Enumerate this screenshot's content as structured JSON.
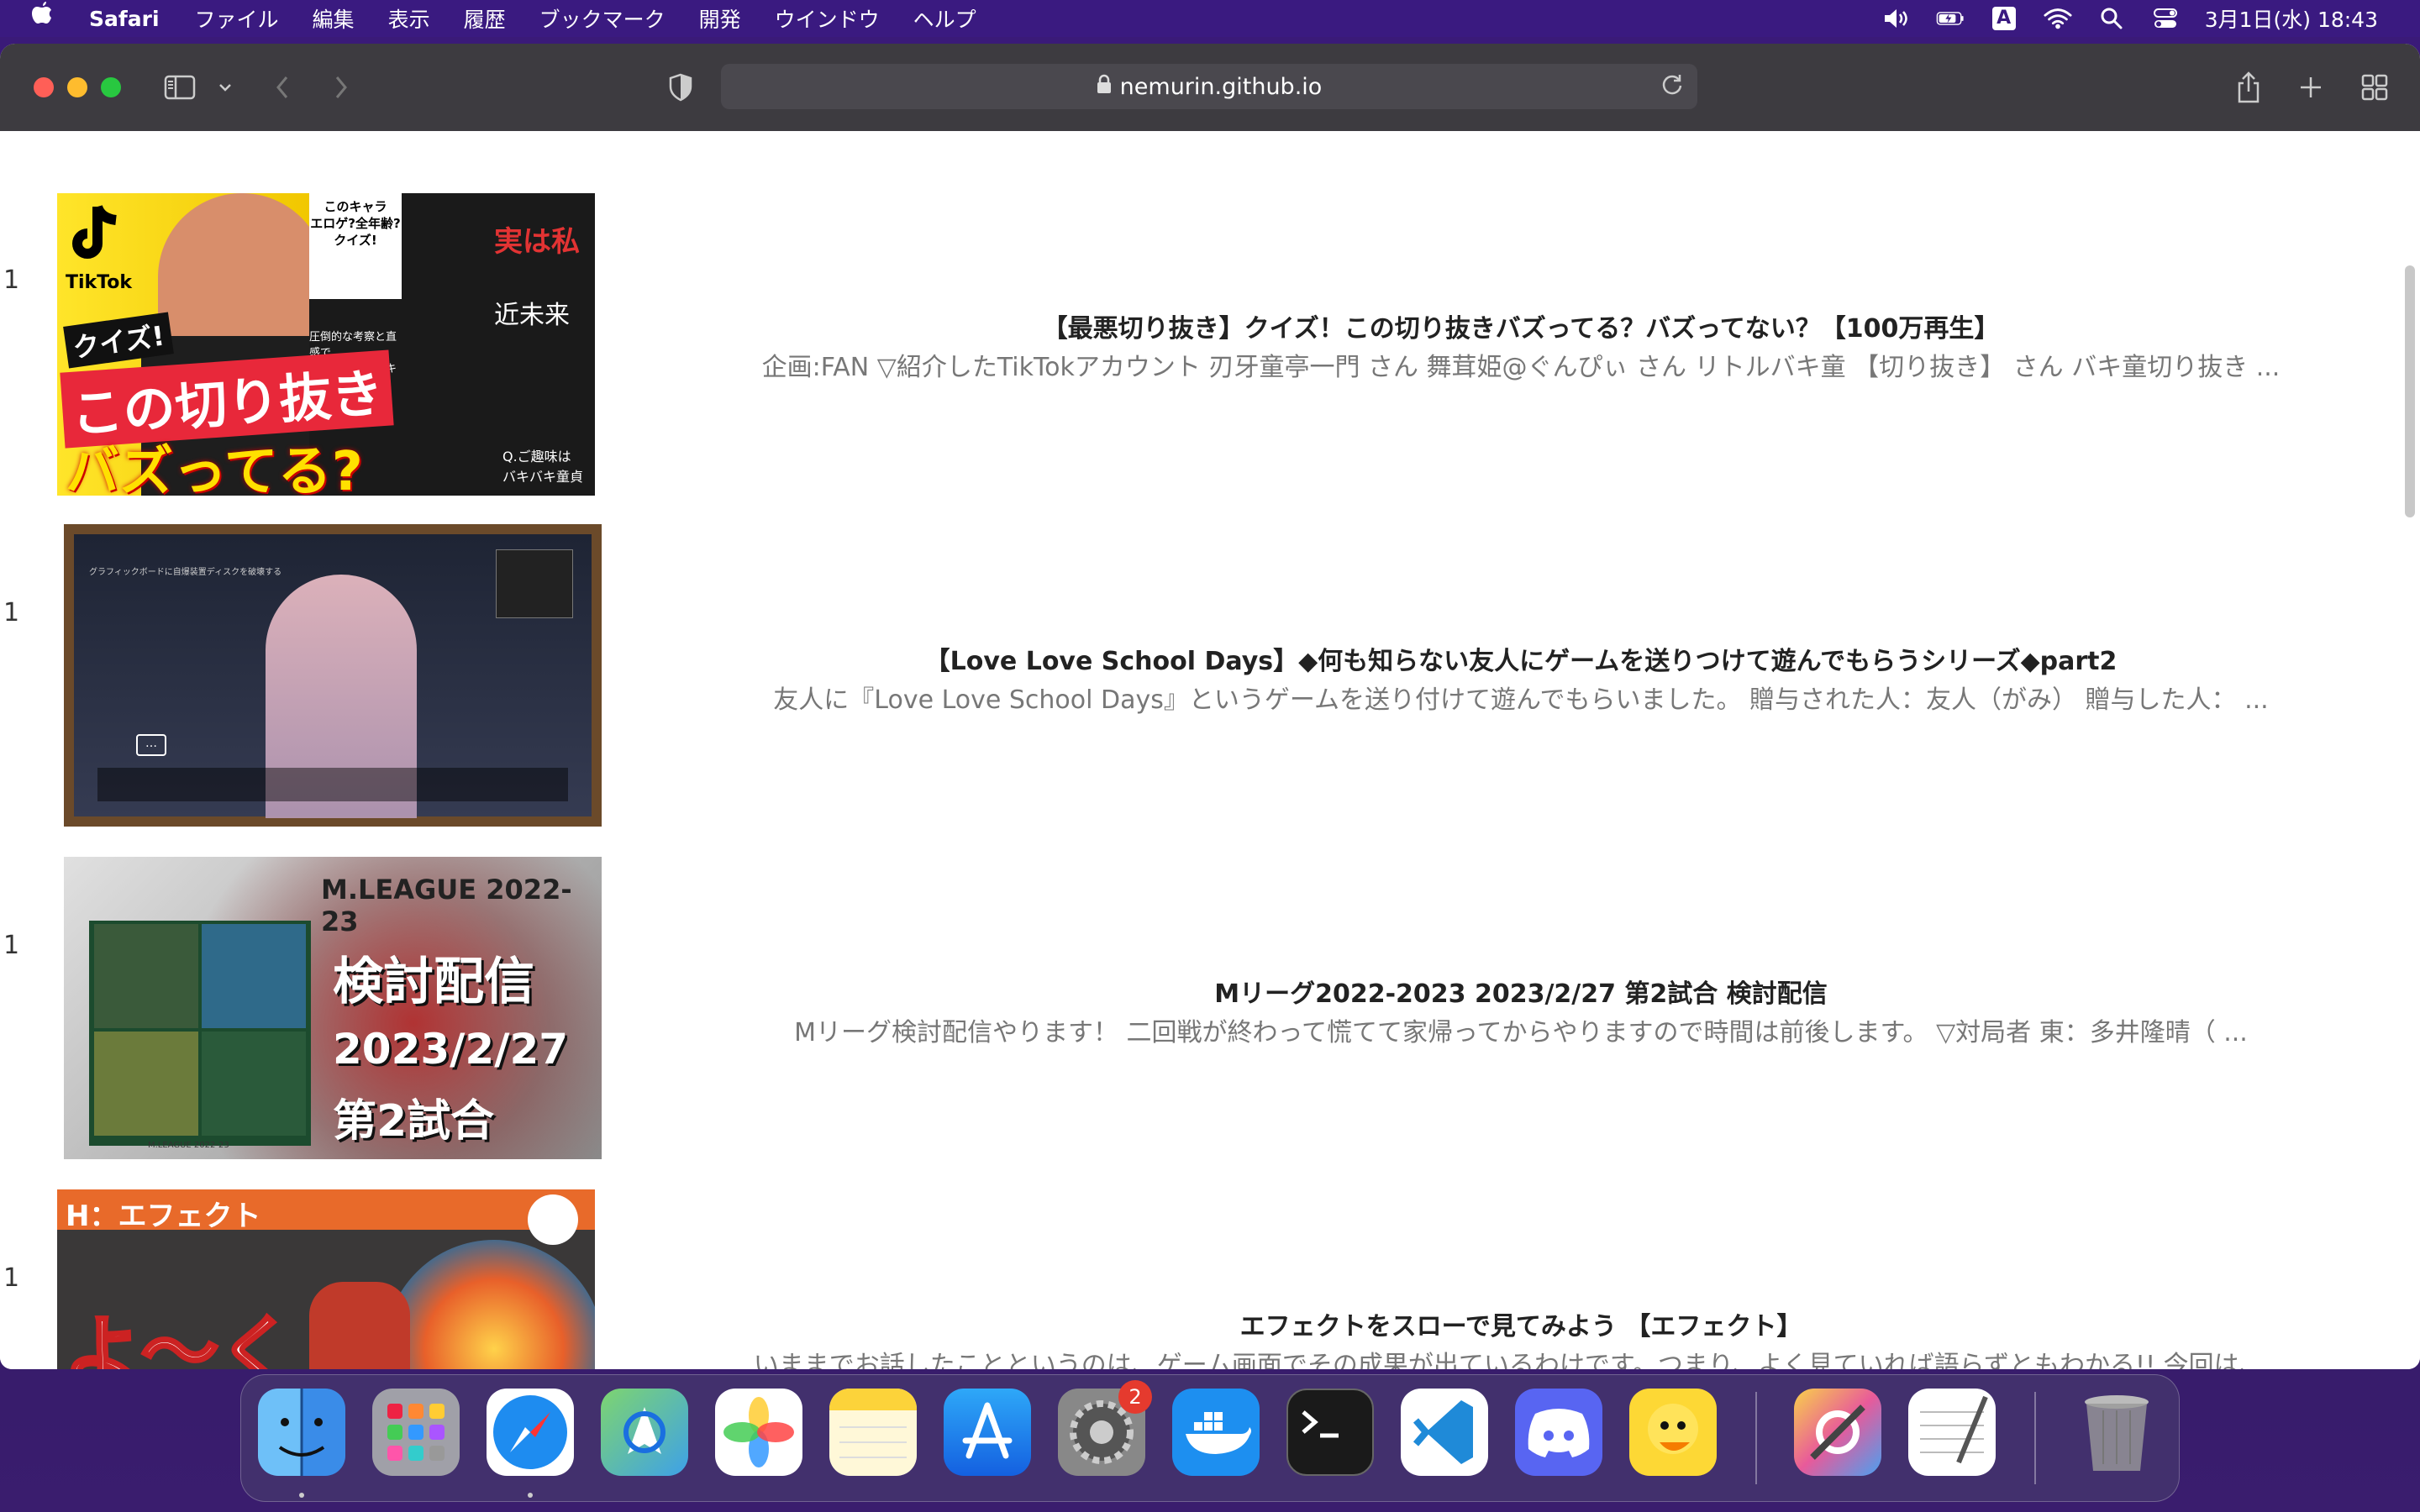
{
  "menubar": {
    "app_name": "Safari",
    "items": [
      "ファイル",
      "編集",
      "表示",
      "履歴",
      "ブックマーク",
      "開発",
      "ウインドウ",
      "ヘルプ"
    ],
    "input_mode": "A",
    "datetime": "3月1日(水)  18:43"
  },
  "browser": {
    "url": "nemurin.github.io"
  },
  "videos": [
    {
      "rank": "1",
      "title": "【最悪切り抜き】クイズ！この切り抜きバズってる？バズってない？【100万再生】",
      "description": "企画:FAN ▽紹介したTikTokアカウント 刃牙童亭一門 さん 舞茸姫@ぐんぴぃ さん リトルバキ童 【切り抜き】 さん バキ童切り抜き ...",
      "thumb_text": {
        "tiktok": "TikTok",
        "quiz": "クイズ!",
        "main": "この切り抜き",
        "main2": "バズってる?",
        "top": "このキャラ\nエロゲ?全年齢?\nクイズ!",
        "jitsu": "実は私",
        "kinmirai": "近未来",
        "caption": "圧倒的な考察と直感で\n当てるバキ童ニキw",
        "q": "Q.ご趣味は\nバキバキ童貞"
      }
    },
    {
      "rank": "1",
      "title": "【Love Love School Days】◆何も知らない友人にゲームを送りつけて遊んでもらうシリーズ◆part2",
      "description": "友人に『Love Love School Days』というゲームを送り付けて遊んでもらいました。 贈与された人：友人（がみ） 贈与した人： ...",
      "thumb_text": {
        "hint": "グラフィックボードに自爆装置ディスクを破壊する",
        "bubble": "…"
      }
    },
    {
      "rank": "1",
      "title": "Mリーグ2022-2023 2023/2/27 第2試合 検討配信",
      "description": "Mリーグ検討配信やります！ 二回戦が終わって慌てて家帰ってからやりますので時間は前後します。 ▽対局者 東：多井隆晴（ ...",
      "thumb_text": {
        "league": "M.LEAGUE 2022-23",
        "kentou": "検討配信",
        "date": "2023/2/27",
        "game": "第2試合",
        "footer": "M.LEAGUE 2022-23"
      }
    },
    {
      "rank": "1",
      "title": "エフェクトをスローで見てみよう 【エフェクト】",
      "description": "いままでお話したことというのは、ゲーム画面でその成果が出ているわけです。つまり、よく見ていれば語らずともわかる!! 今回は、...",
      "thumb_text": {
        "header": "H：エフェクト",
        "big": "よ〜く"
      }
    }
  ],
  "dock": {
    "items": [
      "finder-icon",
      "launchpad-icon",
      "safari-icon",
      "maps-icon",
      "photos-icon",
      "notes-icon",
      "app-store-icon",
      "system-settings-icon",
      "docker-icon",
      "terminal-icon",
      "vscode-icon",
      "discord-icon",
      "cyberduck-icon",
      "colorsync-utility-icon",
      "textedit-icon",
      "trash-icon"
    ],
    "settings_badge": "2"
  },
  "colors": {
    "menubar": "#3a1a80",
    "toolbar": "#3d3b40",
    "title_text": "#222222",
    "desc_text": "#777777"
  }
}
